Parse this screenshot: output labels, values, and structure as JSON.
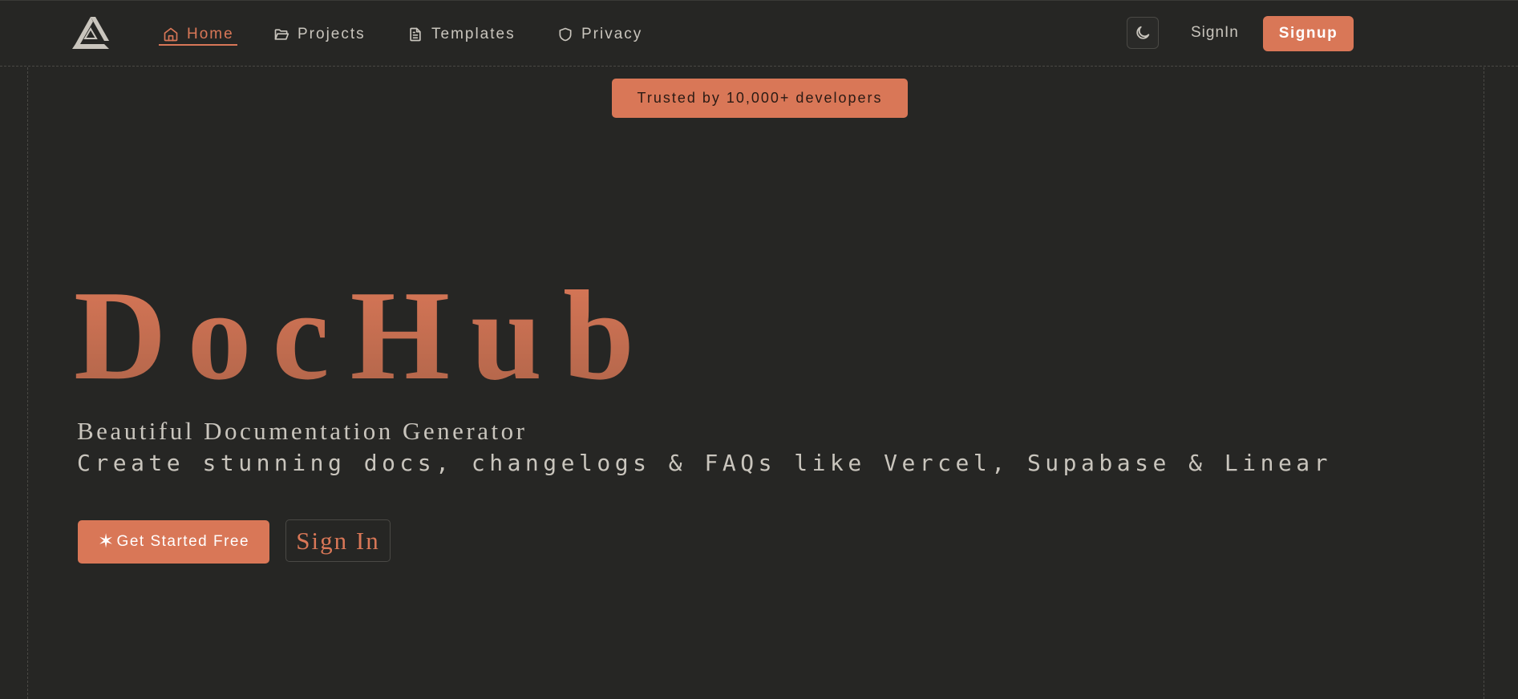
{
  "nav": {
    "items": [
      {
        "label": "Home",
        "icon": "home-icon",
        "active": true
      },
      {
        "label": "Projects",
        "icon": "folder-icon",
        "active": false
      },
      {
        "label": "Templates",
        "icon": "file-icon",
        "active": false
      },
      {
        "label": "Privacy",
        "icon": "shield-icon",
        "active": false
      }
    ],
    "theme_toggle_icon": "moon-icon",
    "signin_label": "SignIn",
    "signup_label": "Signup"
  },
  "badge": {
    "text": "Trusted by 10,000+ developers"
  },
  "hero": {
    "title": "DocHub",
    "subtitle": "Beautiful Documentation Generator",
    "tagline": "Create stunning docs, changelogs & FAQs like Vercel, Supabase & Linear",
    "primary_cta": "Get Started Free",
    "primary_cta_icon": "sparkle-icon",
    "secondary_cta": "Sign In"
  },
  "colors": {
    "background": "#262624",
    "accent": "#d97757",
    "text": "#c9c5bd",
    "border": "#4a4945"
  }
}
